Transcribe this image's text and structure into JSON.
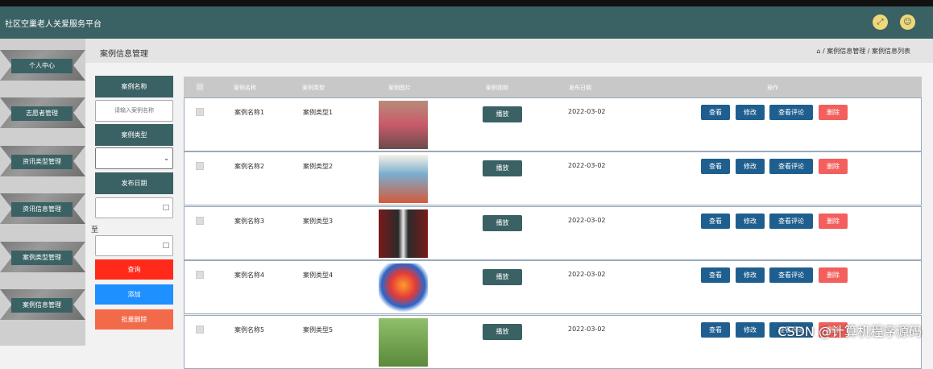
{
  "app": {
    "title": "社区空巢老人关爱服务平台"
  },
  "header": {
    "left_icon": "fullscreen-icon",
    "right_icon": "user-icon"
  },
  "sidebar": {
    "items": [
      {
        "label": "个人中心"
      },
      {
        "label": "志愿者管理"
      },
      {
        "label": "资讯类型管理"
      },
      {
        "label": "资讯信息管理"
      },
      {
        "label": "案例类型管理"
      },
      {
        "label": "案例信息管理"
      }
    ]
  },
  "page": {
    "title": "案例信息管理",
    "breadcrumb": "/ 案例信息管理 / 案例信息列表",
    "home_icon": "home-icon"
  },
  "filters": {
    "name_label": "案例名称",
    "name_placeholder": "请输入案例名称",
    "type_label": "案例类型",
    "type_value": "",
    "date_label": "发布日期",
    "to_label": "至",
    "search_btn": "查询",
    "add_btn": "添加",
    "batch_delete_btn": "批量删除"
  },
  "table": {
    "headers": [
      "案例名称",
      "案例类型",
      "案例图片",
      "案例视频",
      "发布日期",
      "操作"
    ],
    "rows": [
      {
        "name": "案例名称1",
        "type": "案例类型1",
        "video_btn": "播放",
        "date": "2022-03-02"
      },
      {
        "name": "案例名称2",
        "type": "案例类型2",
        "video_btn": "播放",
        "date": "2022-03-02"
      },
      {
        "name": "案例名称3",
        "type": "案例类型3",
        "video_btn": "播放",
        "date": "2022-03-02"
      },
      {
        "name": "案例名称4",
        "type": "案例类型4",
        "video_btn": "播放",
        "date": "2022-03-02"
      },
      {
        "name": "案例名称5",
        "type": "案例类型5",
        "video_btn": "播放",
        "date": "2022-03-02"
      }
    ],
    "actions": {
      "view": "查看",
      "edit": "修改",
      "comments": "查看评论",
      "delete": "删除"
    }
  },
  "watermark": "CSDN @计算机程序源码",
  "colors": {
    "primary": "#3a6163",
    "action_blue": "#1f5f8f",
    "danger": "#f25f5c",
    "search_red": "#ff2a1a",
    "add_blue": "#1e90ff",
    "batch_delete_orange": "#f36a4a"
  }
}
